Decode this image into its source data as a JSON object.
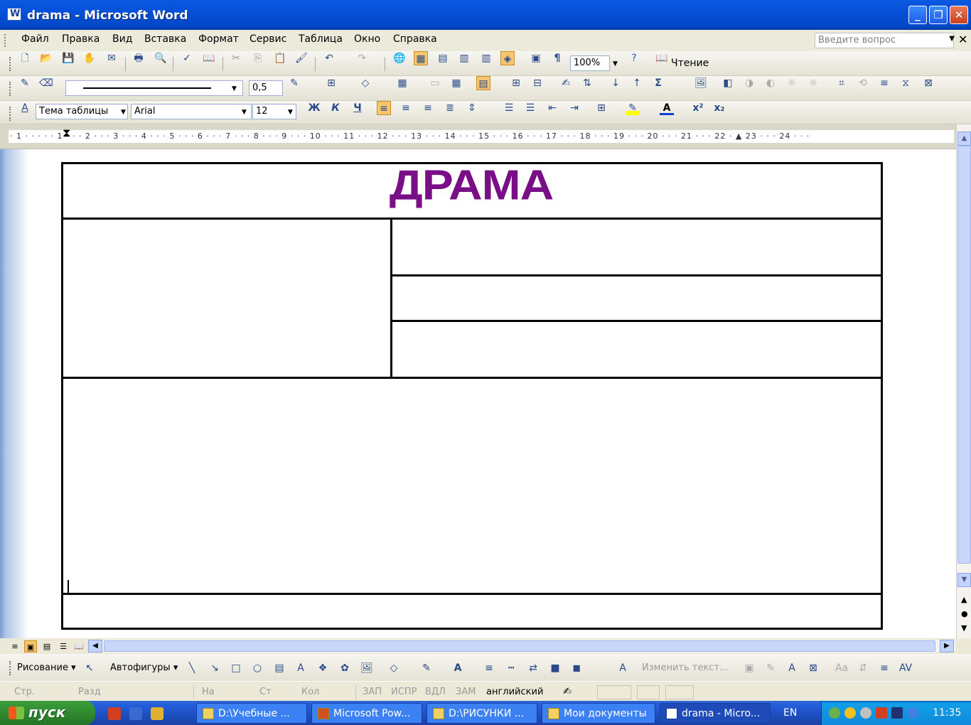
{
  "window": {
    "title": "drama - Microsoft Word",
    "min": "_",
    "max": "❐",
    "close": "✕"
  },
  "menu": {
    "items": [
      "Файл",
      "Правка",
      "Вид",
      "Вставка",
      "Формат",
      "Сервис",
      "Таблица",
      "Окно",
      "Справка"
    ],
    "help_placeholder": "Введите вопрос",
    "close": "✕"
  },
  "toolbar1": {
    "zoom": "100%",
    "reading": "Чтение",
    "pilcrow": "¶"
  },
  "toolbar2": {
    "line_weight": "0,5",
    "sigma": "Σ"
  },
  "format": {
    "style": "Тема таблицы",
    "font": "Arial",
    "size": "12",
    "bold": "Ж",
    "italic": "К",
    "underline": "Ч",
    "superscript": "x²",
    "subscript": "x₂"
  },
  "ruler": {
    "text": "· 1 · ·   · · · 1 · · · 2 · · · 3 · · · 4 · · · 5 · · · 6 · · · 7 · · · 8 · · · 9 · · · 10 · · · 11 · · · 12 · · · 13 · · · 14 · · · 15 · · · 16 · · · 17 · · · 18 · · · 19 · · · 20 · · · 21 · · · 22 · ▲ 23 · · · 24 · · ·"
  },
  "document": {
    "title": "ДРАМА",
    "title_color": "#7a0e86"
  },
  "drawing": {
    "draw_label": "Рисование ▾",
    "autoshapes": "Автофигуры ▾",
    "change_text": "Изменить текст..."
  },
  "status": {
    "page": "Стр.",
    "section": "Разд",
    "at": "На",
    "line": "Ст",
    "col": "Кол",
    "rec": "ЗАП",
    "trk": "ИСПР",
    "ext": "ВДЛ",
    "ovr": "ЗАМ",
    "language": "английский"
  },
  "taskbar": {
    "start": "пуск",
    "tasks": [
      "D:\\Учебные ...",
      "Microsoft Pow...",
      "D:\\РИСУНКИ ...",
      "Мои документы",
      "drama - Micro..."
    ],
    "lang": "EN",
    "time": "11:35"
  }
}
